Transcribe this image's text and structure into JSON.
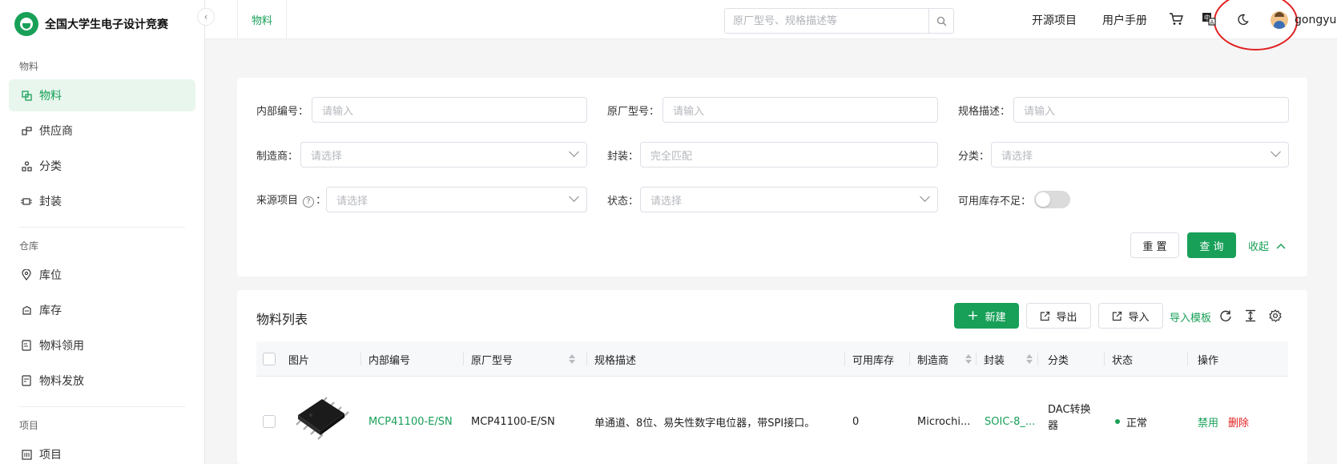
{
  "sidebar": {
    "brand_title": "全国大学生电子设计竞赛",
    "groups": [
      {
        "title": "物料",
        "items": [
          {
            "label": "物料",
            "icon": "copy-icon",
            "active": true
          },
          {
            "label": "供应商",
            "icon": "supplier-icon"
          },
          {
            "label": "分类",
            "icon": "category-icon"
          },
          {
            "label": "封装",
            "icon": "package-icon"
          }
        ]
      },
      {
        "title": "仓库",
        "items": [
          {
            "label": "库位",
            "icon": "location-icon"
          },
          {
            "label": "库存",
            "icon": "inventory-icon"
          },
          {
            "label": "物料领用",
            "icon": "requisition-icon"
          },
          {
            "label": "物料发放",
            "icon": "issue-icon"
          }
        ]
      },
      {
        "title": "项目",
        "items": [
          {
            "label": "项目",
            "icon": "project-icon"
          }
        ]
      }
    ]
  },
  "topbar": {
    "active_tab": "物料",
    "search_placeholder": "原厂型号、规格描述等",
    "open_source_projects": "开源项目",
    "user_manual": "用户手册",
    "username": "gongyu"
  },
  "filters": {
    "internal_no": {
      "label": "内部编号",
      "placeholder": "请输入"
    },
    "mfr_part_no": {
      "label": "原厂型号",
      "placeholder": "请输入"
    },
    "spec_desc": {
      "label": "规格描述",
      "placeholder": "请输入"
    },
    "manufacturer": {
      "label": "制造商",
      "placeholder": "请选择"
    },
    "package": {
      "label": "封装",
      "placeholder": "完全匹配"
    },
    "category": {
      "label": "分类",
      "placeholder": "请选择"
    },
    "source_project": {
      "label": "来源项目",
      "placeholder": "请选择"
    },
    "status": {
      "label": "状态",
      "placeholder": "请选择"
    },
    "low_stock": {
      "label": "可用库存不足",
      "value": false
    },
    "reset_label": "重 置",
    "query_label": "查 询",
    "collapse_label": "收起"
  },
  "list": {
    "title": "物料列表",
    "new_label": "新建",
    "export_label": "导出",
    "import_label": "导入",
    "import_template_label": "导入模板",
    "columns": [
      "图片",
      "内部编号",
      "原厂型号",
      "规格描述",
      "可用库存",
      "制造商",
      "封装",
      "分类",
      "状态",
      "操作"
    ],
    "rows": [
      {
        "internal_no": "MCP41100-E/SN",
        "mfr_part_no": "MCP41100-E/SN",
        "spec_desc": "单通道、8位、易失性数字电位器，带SPI接口。",
        "available_stock": "0",
        "manufacturer": "Microchi...",
        "package": "SOIC-8_...",
        "category_line1": "DAC转换",
        "category_line2": "器",
        "status": "正常",
        "action_disable": "禁用",
        "action_delete": "删除"
      }
    ]
  },
  "colors": {
    "accent": "#18a058",
    "danger": "#e02020"
  }
}
